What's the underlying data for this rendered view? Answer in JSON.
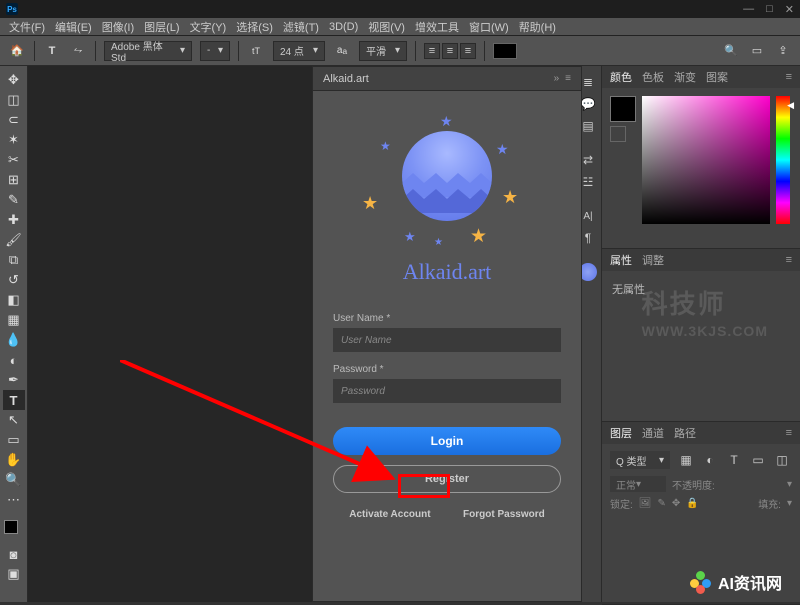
{
  "window": {
    "min": "—",
    "max": "□",
    "close": "✕"
  },
  "menu": [
    "文件(F)",
    "编辑(E)",
    "图像(I)",
    "图层(L)",
    "文字(Y)",
    "选择(S)",
    "滤镜(T)",
    "3D(D)",
    "视图(V)",
    "增效工具",
    "窗口(W)",
    "帮助(H)"
  ],
  "options": {
    "font_family": "Adobe 黑体 Std",
    "font_style": "-",
    "font_size": "24 点",
    "anti_alias": "平滑"
  },
  "extension": {
    "title": "Alkaid.art",
    "brand": "Alkaid.art",
    "username_label": "User Name *",
    "username_placeholder": "User Name",
    "password_label": "Password *",
    "password_placeholder": "Password",
    "login": "Login",
    "register": "Register",
    "activate": "Activate Account",
    "forgot": "Forgot Password"
  },
  "panels": {
    "color_tabs": [
      "颜色",
      "色板",
      "渐变",
      "图案"
    ],
    "prop_tabs": [
      "属性",
      "调整"
    ],
    "prop_empty": "无属性",
    "layer_tabs": [
      "图层",
      "通道",
      "路径"
    ],
    "layer_kind": "Q 类型",
    "layer_mode": "正常",
    "layer_opacity_lbl": "不透明度:",
    "layer_lock_lbl": "锁定:",
    "layer_fill_lbl": "填充:"
  },
  "watermark1": {
    "main": "科技师",
    "sub": "WWW.3KJS.COM"
  },
  "watermark2": "AI资讯网"
}
